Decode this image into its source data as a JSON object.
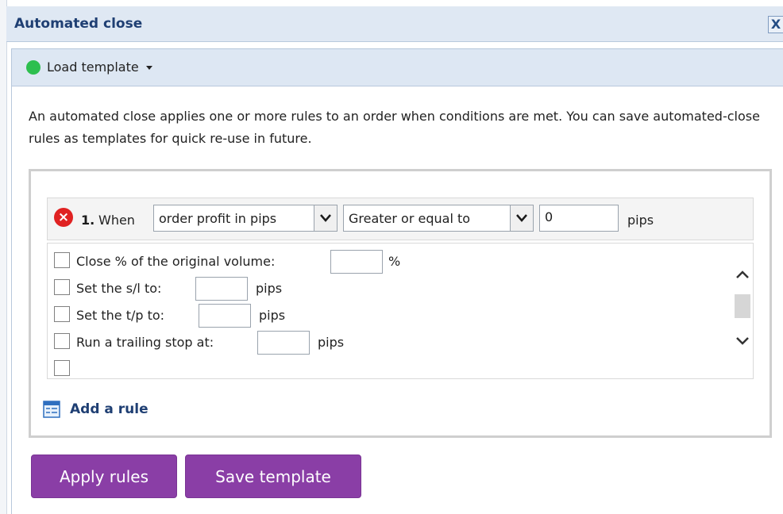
{
  "window": {
    "title": "Automated close",
    "close_glyph": "X"
  },
  "toolbar": {
    "template_label": "Load template",
    "status_color": "#2dbf4f"
  },
  "intro_text": "An automated close applies one or more rules to an order when conditions are met. You can save automated-close rules as templates for quick re-use in future.",
  "rule": {
    "number": "1.",
    "when_label": "When",
    "condition_value": "order profit in pips",
    "operator_value": "Greater or equal to",
    "threshold_value": "0",
    "threshold_unit": "pips"
  },
  "options": [
    {
      "label": "Close % of the original volume:",
      "value": "",
      "unit": "%"
    },
    {
      "label": "Set the s/l to:",
      "value": "",
      "unit": "pips"
    },
    {
      "label": "Set the t/p to:",
      "value": "",
      "unit": "pips"
    },
    {
      "label": "Run a trailing stop at:",
      "value": "",
      "unit": "pips"
    }
  ],
  "add_rule_label": "Add a rule",
  "buttons": {
    "apply": "Apply rules",
    "save": "Save template"
  },
  "colors": {
    "accent": "#8a3ea6",
    "title": "#1f3f73",
    "delete": "#e02222"
  }
}
